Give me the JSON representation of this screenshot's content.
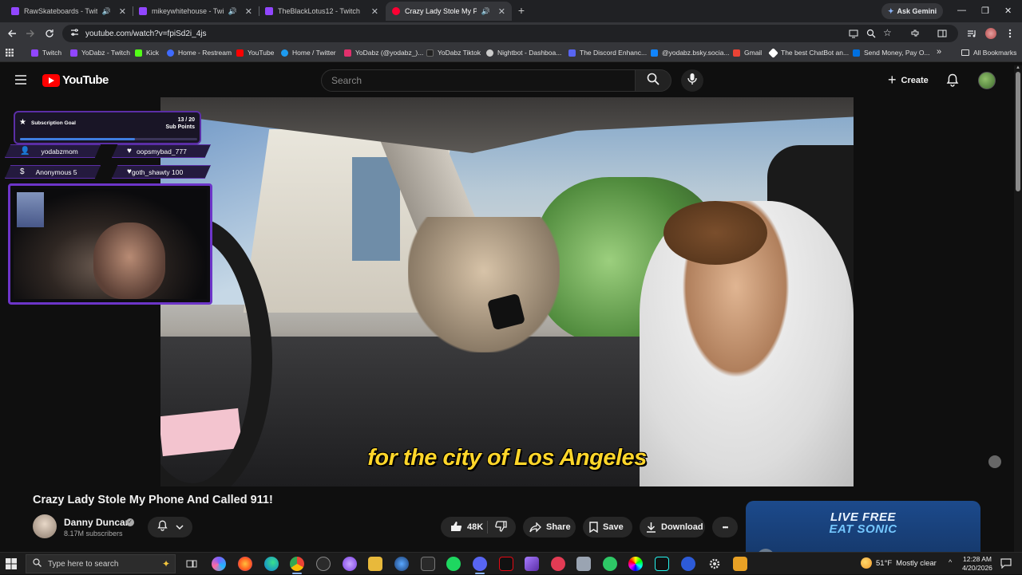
{
  "browser": {
    "tabs": [
      {
        "title": "RawSkateboards - Twitch",
        "audio": true,
        "active": false,
        "favicon_color": "#9146ff"
      },
      {
        "title": "mikeywhitehouse - Twitch",
        "audio": true,
        "active": false,
        "favicon_color": "#9146ff"
      },
      {
        "title": "TheBlackLotus12 - Twitch",
        "audio": false,
        "active": false,
        "favicon_color": "#9146ff"
      },
      {
        "title": "Crazy Lady Stole My Phone",
        "audio": true,
        "active": true,
        "favicon_color": "#ff0033"
      }
    ],
    "new_tab_label": "+",
    "gemini_label": "Ask Gemini",
    "url": "youtube.com/watch?v=fpiSd2i_4js",
    "bookmarks": [
      {
        "label": "Twitch",
        "color": "#9146ff"
      },
      {
        "label": "YoDabz - Twitch",
        "color": "#9146ff"
      },
      {
        "label": "Kick",
        "color": "#53fc18"
      },
      {
        "label": "Home - Restream",
        "color": "#3f6bff"
      },
      {
        "label": "YouTube",
        "color": "#ff0000"
      },
      {
        "label": "Home / Twitter",
        "color": "#1d9bf0"
      },
      {
        "label": "YoDabz (@yodabz_)...",
        "color": "#e1306c"
      },
      {
        "label": "YoDabz Tiktok",
        "color": "#222222"
      },
      {
        "label": "Nightbot - Dashboa...",
        "color": "#cccccc"
      },
      {
        "label": "The Discord Enhanc...",
        "color": "#5865f2"
      },
      {
        "label": "@yodabz.bsky.socia...",
        "color": "#1185fe"
      },
      {
        "label": "Gmail",
        "color": "#ea4335"
      },
      {
        "label": "The best ChatBot an...",
        "color": "#ffffff"
      },
      {
        "label": "Send Money, Pay O...",
        "color": "#0070e0"
      }
    ],
    "bookmarks_more": "»",
    "all_bookmarks_label": "All Bookmarks"
  },
  "youtube": {
    "logo_text": "YouTube",
    "search_placeholder": "Search",
    "create_label": "Create",
    "caption_text": "for the city of Los Angeles",
    "video_title": "Crazy Lady Stole My Phone And Called 911!",
    "channel_name": "Danny Duncan",
    "verified_mark": "✓",
    "subscriber_count": "8.17M subscribers",
    "like_count": "48K",
    "share_label": "Share",
    "save_label": "Save",
    "download_label": "Download",
    "more_label": "•••",
    "promo_line1": "LIVE FREE",
    "promo_line2": "EAT SONIC"
  },
  "overlay": {
    "goal_title": "Subscription Goal",
    "goal_count": "13 / 20",
    "goal_unit": "Sub Points",
    "goal_progress": 0.65,
    "chips": [
      {
        "icon": "person-icon",
        "text": "yodabzmom"
      },
      {
        "icon": "heart-icon",
        "text": "oopsmybad_777"
      },
      {
        "icon": "dollar-icon",
        "text": "Anonymous 5"
      },
      {
        "icon": "heart-icon",
        "text": "goth_shawty 100"
      }
    ]
  },
  "taskbar": {
    "search_placeholder": "Type here to search",
    "weather_temp": "51°F",
    "weather_desc": "Mostly clear",
    "time": "12:28 AM",
    "date": "4/20/2026",
    "tray_chevron": "^"
  }
}
